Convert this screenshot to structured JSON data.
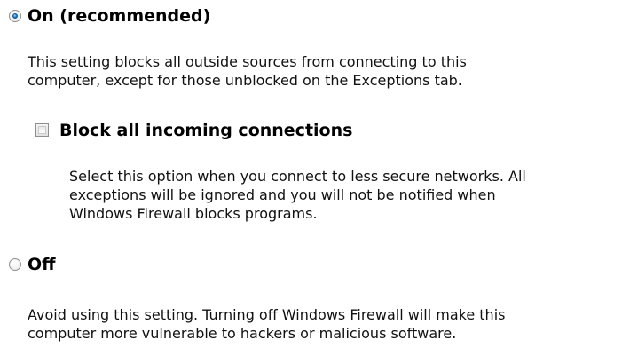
{
  "firewall": {
    "on_option": {
      "label": "On (recommended)",
      "selected": true,
      "description": [
        "This setting blocks all outside sources from connecting to this",
        "computer, except for those unblocked on the Exceptions tab."
      ]
    },
    "block_incoming": {
      "label": "Block all incoming connections",
      "checked": false,
      "description": [
        "Select this option when you connect to less secure networks. All",
        "exceptions will be ignored and you will not be notified when",
        "Windows Firewall blocks programs."
      ]
    },
    "off_option": {
      "label": "Off",
      "selected": false,
      "description": [
        "Avoid using this setting. Turning off Windows Firewall will make this",
        "computer more vulnerable to hackers or malicious software."
      ]
    }
  }
}
